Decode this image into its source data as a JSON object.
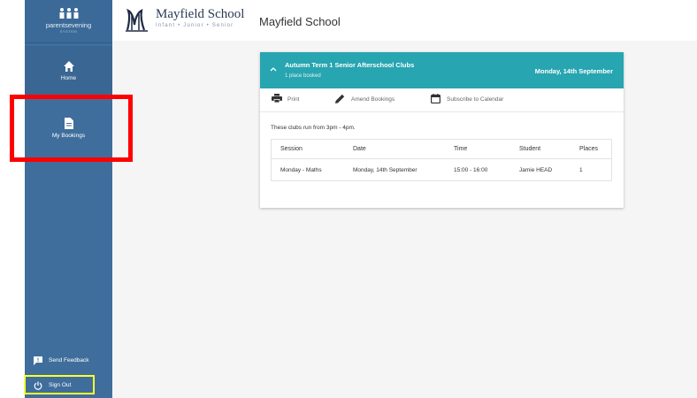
{
  "brand": {
    "name": "parentsevening",
    "sub": "SYSTEM"
  },
  "sidebar": {
    "items": [
      {
        "label": "Home",
        "icon": "home-icon"
      },
      {
        "label": "My Bookings",
        "icon": "document-icon"
      }
    ],
    "feedback_label": "Send Feedback",
    "signout_label": "Sign Out"
  },
  "header": {
    "school_name": "Mayfield School",
    "school_tagline": "Infant • Junior • Senior",
    "title": "Mayfield School"
  },
  "booking": {
    "title": "Autumn Term 1 Senior Afterschool Clubs",
    "subtitle": "1 place booked",
    "date": "Monday, 14th September",
    "actions": {
      "print": "Print",
      "amend": "Amend Bookings",
      "subscribe": "Subscribe to Calendar"
    },
    "intro": "These clubs run from 3pm - 4pm.",
    "table": {
      "headers": [
        "Session",
        "Date",
        "Time",
        "Student",
        "Places"
      ],
      "rows": [
        [
          "Monday - Maths",
          "Monday, 14th September",
          "15:00 - 16:00",
          "Jamie HEAD",
          "1"
        ]
      ]
    }
  },
  "colors": {
    "sidebar": "#3f6e9c",
    "card_header": "#27a5b0",
    "annotation_red": "#ff0000",
    "annotation_yellow": "#ffff2e"
  }
}
